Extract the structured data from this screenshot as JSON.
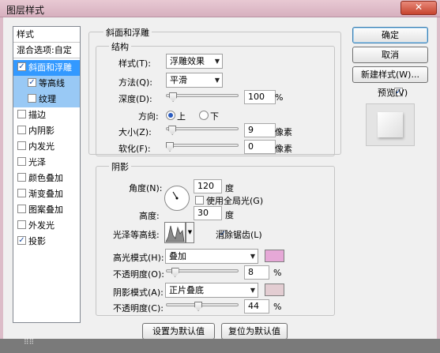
{
  "window": {
    "title": "图层样式",
    "close": "✕"
  },
  "style_list": {
    "header": "样式",
    "blend": "混合选项:自定",
    "items": [
      {
        "label": "斜面和浮雕",
        "checked": true
      },
      {
        "label": "等高线",
        "checked": true
      },
      {
        "label": "纹理",
        "checked": false
      },
      {
        "label": "描边",
        "checked": false
      },
      {
        "label": "内阴影",
        "checked": false
      },
      {
        "label": "内发光",
        "checked": false
      },
      {
        "label": "光泽",
        "checked": false
      },
      {
        "label": "颜色叠加",
        "checked": false
      },
      {
        "label": "渐变叠加",
        "checked": false
      },
      {
        "label": "图案叠加",
        "checked": false
      },
      {
        "label": "外发光",
        "checked": false
      },
      {
        "label": "投影",
        "checked": true
      }
    ]
  },
  "bevel": {
    "title": "斜面和浮雕",
    "structure_title": "结构",
    "style_label": "样式(T):",
    "style_value": "浮雕效果",
    "technique_label": "方法(Q):",
    "technique_value": "平滑",
    "depth_label": "深度(D):",
    "depth_value": "100",
    "depth_pct": 0.05,
    "depth_unit": "%",
    "direction_label": "方向:",
    "direction_up": "上",
    "direction_down": "下",
    "size_label": "大小(Z):",
    "size_value": "9",
    "size_pct": 0.04,
    "size_unit": "像素",
    "soften_label": "软化(F):",
    "soften_value": "0",
    "soften_pct": 0.0,
    "soften_unit": "像素"
  },
  "shading": {
    "title": "阴影",
    "angle_label": "角度(N):",
    "angle_value": "120",
    "angle_unit": "度",
    "global_light_label": "使用全局光(G)",
    "altitude_label": "高度:",
    "altitude_value": "30",
    "altitude_unit": "度",
    "gloss_label": "光泽等高线:",
    "antialias_label": "消除锯齿(L)",
    "highlight_label": "高光模式(H):",
    "highlight_value": "叠加",
    "highlight_color": "#e6a8d7",
    "highlight_opacity_label": "不透明度(O):",
    "highlight_opacity_value": "8",
    "highlight_opacity_pct": 0.08,
    "shadow_label": "阴影模式(A):",
    "shadow_value": "正片叠底",
    "shadow_color": "#e3cdd2",
    "shadow_opacity_label": "不透明度(C):",
    "shadow_opacity_value": "44",
    "shadow_opacity_pct": 0.44,
    "pct_unit": "%"
  },
  "buttons": {
    "ok": "确定",
    "cancel": "取消",
    "new_style": "新建样式(W)...",
    "preview": "预览(V)",
    "set_default": "设置为默认值",
    "reset_default": "复位为默认值"
  }
}
